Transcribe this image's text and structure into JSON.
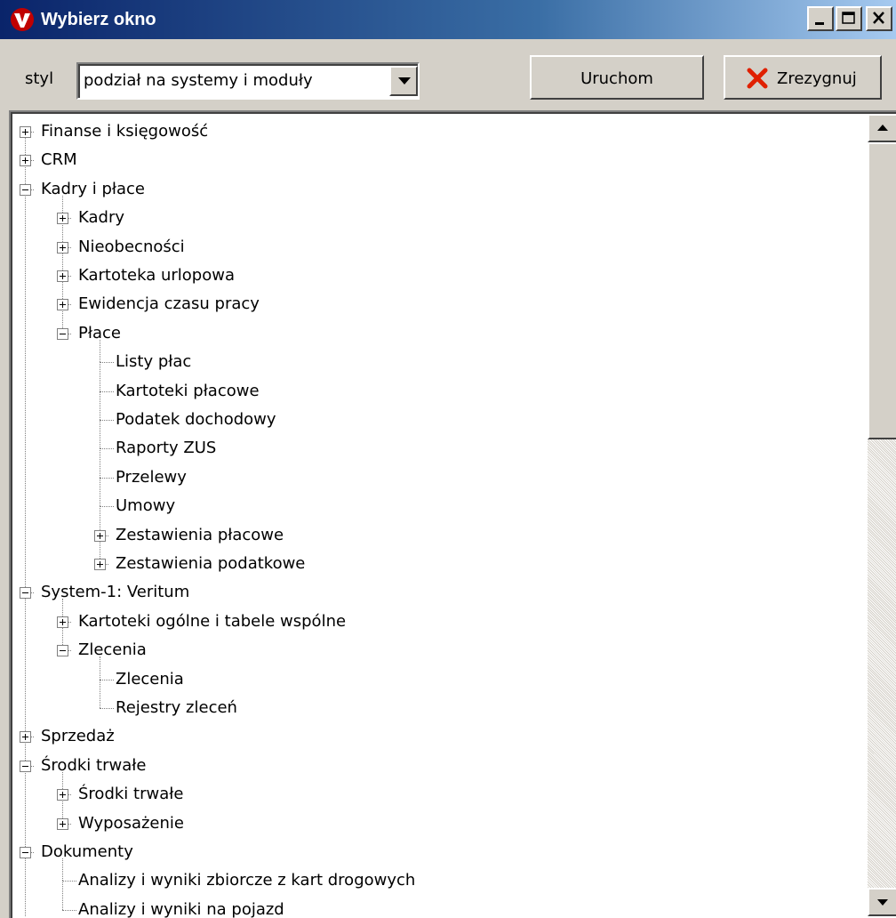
{
  "window": {
    "title": "Wybierz okno"
  },
  "toolbar": {
    "style_label": "styl",
    "style_value": "podział na systemy i moduły",
    "run_label": "Uruchom",
    "cancel_label": "Zrezygnuj"
  },
  "tree": [
    {
      "label": "Finanse i księgowość",
      "level": 0,
      "state": "collapsed"
    },
    {
      "label": "CRM",
      "level": 0,
      "state": "collapsed"
    },
    {
      "label": "Kadry i płace",
      "level": 0,
      "state": "expanded"
    },
    {
      "label": "Kadry",
      "level": 1,
      "state": "collapsed"
    },
    {
      "label": "Nieobecności",
      "level": 1,
      "state": "collapsed"
    },
    {
      "label": "Kartoteka urlopowa",
      "level": 1,
      "state": "collapsed"
    },
    {
      "label": "Ewidencja czasu pracy",
      "level": 1,
      "state": "collapsed"
    },
    {
      "label": "Płace",
      "level": 1,
      "state": "expanded"
    },
    {
      "label": "Listy płac",
      "level": 2,
      "state": "leaf"
    },
    {
      "label": "Kartoteki płacowe",
      "level": 2,
      "state": "leaf"
    },
    {
      "label": "Podatek dochodowy",
      "level": 2,
      "state": "leaf"
    },
    {
      "label": "Raporty ZUS",
      "level": 2,
      "state": "leaf"
    },
    {
      "label": "Przelewy",
      "level": 2,
      "state": "leaf"
    },
    {
      "label": "Umowy",
      "level": 2,
      "state": "leaf"
    },
    {
      "label": "Zestawienia płacowe",
      "level": 2,
      "state": "collapsed"
    },
    {
      "label": "Zestawienia podatkowe",
      "level": 2,
      "state": "collapsed"
    },
    {
      "label": "System-1: Veritum",
      "level": 0,
      "state": "expanded"
    },
    {
      "label": "Kartoteki ogólne i tabele wspólne",
      "level": 1,
      "state": "collapsed"
    },
    {
      "label": "Zlecenia",
      "level": 1,
      "state": "expanded"
    },
    {
      "label": "Zlecenia",
      "level": 2,
      "state": "leaf"
    },
    {
      "label": "Rejestry zleceń",
      "level": 2,
      "state": "leaf"
    },
    {
      "label": "Sprzedaż",
      "level": 0,
      "state": "collapsed"
    },
    {
      "label": "Środki trwałe",
      "level": 0,
      "state": "expanded"
    },
    {
      "label": "Środki trwałe",
      "level": 1,
      "state": "collapsed"
    },
    {
      "label": "Wyposażenie",
      "level": 1,
      "state": "collapsed"
    },
    {
      "label": "Dokumenty",
      "level": 0,
      "state": "expanded"
    },
    {
      "label": "Analizy i wyniki zbiorcze z kart drogowych",
      "level": 1,
      "state": "leaf"
    },
    {
      "label": "Analizy i wyniki na pojazd",
      "level": 1,
      "state": "leaf"
    }
  ],
  "icons": {
    "app": "v-logo-icon",
    "minimize": "minimize-icon",
    "maximize": "maximize-icon",
    "close": "close-icon",
    "dropdown": "chevron-down-icon",
    "cancel": "red-x-icon",
    "scroll_up": "arrow-up-icon",
    "scroll_down": "arrow-down-icon"
  },
  "colors": {
    "titlebar_start": "#0a246a",
    "titlebar_end": "#a6caf0",
    "face": "#d4d0c8",
    "cancel_x": "#e02000",
    "logo": "#c00000"
  }
}
